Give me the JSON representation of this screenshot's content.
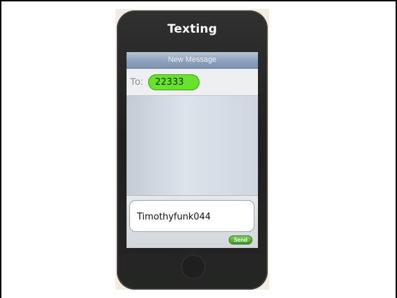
{
  "phone": {
    "title": "Texting"
  },
  "message_screen": {
    "nav_title": "New Message",
    "to_label": "To:",
    "recipient": "22333",
    "message_text": "Timothyfunk044",
    "send_label": "Send"
  },
  "colors": {
    "recipient_bubble": "#66e32a",
    "send_button": "#3e9a22",
    "phone_body": "#252625"
  },
  "icons": {
    "home_button": "home-button-icon"
  }
}
